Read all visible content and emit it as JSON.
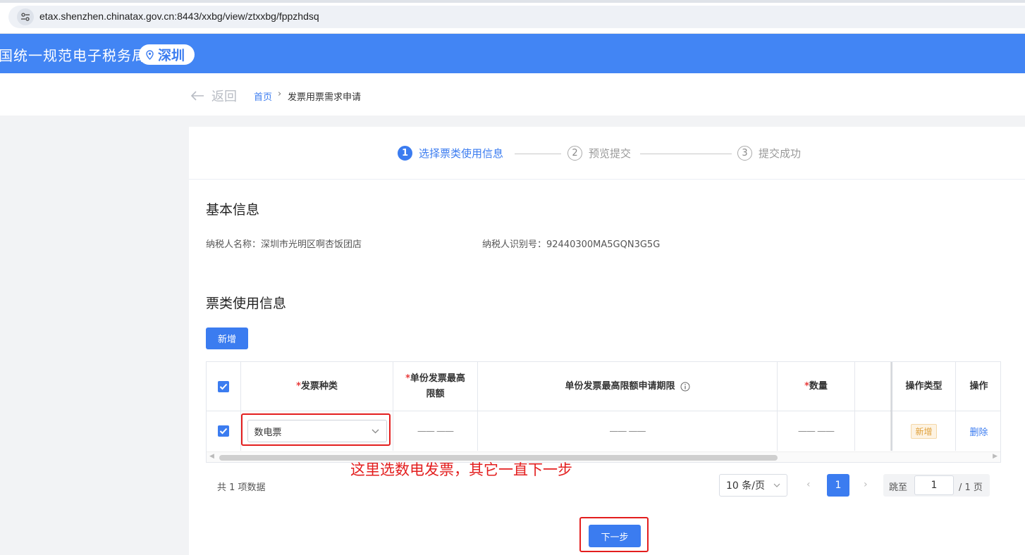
{
  "browser": {
    "url": "etax.shenzhen.chinatax.gov.cn:8443/xxbg/view/ztxxbg/fppzhdsq"
  },
  "header": {
    "brand": "国统一规范电子税务局",
    "region": "深圳"
  },
  "breadcrumb": {
    "back": "返回",
    "home": "首页",
    "separator": "›",
    "current": "发票用票需求申请"
  },
  "steps": [
    {
      "num": "1",
      "label": "选择票类使用信息"
    },
    {
      "num": "2",
      "label": "预览提交"
    },
    {
      "num": "3",
      "label": "提交成功"
    }
  ],
  "basic": {
    "title": "基本信息",
    "taxpayer_name": "纳税人名称：深圳市光明区啊杏饭团店",
    "taxpayer_id": "纳税人识别号：92440300MA5GQN3G5G"
  },
  "ticket": {
    "title": "票类使用信息",
    "add_button": "新增"
  },
  "table": {
    "required_mark": "*",
    "headers": {
      "invoice_type": "发票种类",
      "max_limit": "单份发票最高限额",
      "limit_period": "单份发票最高限额申请期限",
      "quantity": "数量",
      "op_type": "操作类型",
      "op": "操作"
    },
    "rows": [
      {
        "invoice_type": "数电票",
        "max_limit": "—— ——",
        "limit_period": "—— ——",
        "quantity": "—— ——",
        "op_type": "新增",
        "op": "删除"
      }
    ]
  },
  "annotation": "这里选数电发票，其它一直下一步",
  "pagination": {
    "total": "共 1 项数据",
    "page_size": "10 条/页",
    "current_page": "1",
    "jump_label": "跳至",
    "jump_value": "1",
    "total_pages": "/ 1 页"
  },
  "next_button": "下一步",
  "colors": {
    "brand_blue": "#4285f4",
    "primary": "#3b7cf0",
    "annotation_red": "#e31e1e"
  }
}
